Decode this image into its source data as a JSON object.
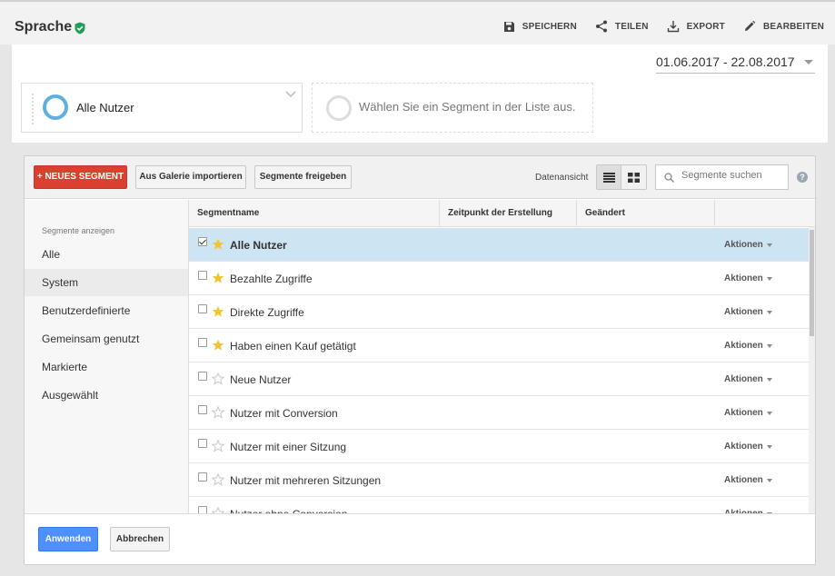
{
  "header": {
    "title": "Sprache",
    "actions": [
      {
        "label": "SPEICHERN",
        "icon": "save-icon"
      },
      {
        "label": "TEILEN",
        "icon": "share-icon"
      },
      {
        "label": "EXPORT",
        "icon": "export-icon"
      },
      {
        "label": "BEARBEITEN",
        "icon": "edit-icon"
      }
    ]
  },
  "segment_bar": {
    "date_range": "01.06.2017 - 22.08.2017",
    "active_segment": "Alle Nutzer",
    "placeholder": "Wählen Sie ein Segment in der Liste aus."
  },
  "toolbar": {
    "new_segment": "+ NEUES SEGMENT",
    "import_gallery": "Aus Galerie importieren",
    "share_segments": "Segmente freigeben",
    "view_label": "Datenansicht",
    "search_placeholder": "Segmente suchen",
    "help": "?"
  },
  "sidebar": {
    "heading": "Segmente anzeigen",
    "items": [
      {
        "label": "Alle",
        "active": false
      },
      {
        "label": "System",
        "active": true
      },
      {
        "label": "Benutzerdefinierte",
        "active": false
      },
      {
        "label": "Gemeinsam genutzt",
        "active": false
      },
      {
        "label": "Markierte",
        "active": false
      },
      {
        "label": "Ausgewählt",
        "active": false
      }
    ]
  },
  "table": {
    "columns": [
      "Segmentname",
      "Zeitpunkt der Erstellung",
      "Geändert"
    ],
    "action_label": "Aktionen",
    "rows": [
      {
        "name": "Alle Nutzer",
        "starred": true,
        "checked": true,
        "selected": true
      },
      {
        "name": "Bezahlte Zugriffe",
        "starred": true,
        "checked": false,
        "selected": false
      },
      {
        "name": "Direkte Zugriffe",
        "starred": true,
        "checked": false,
        "selected": false
      },
      {
        "name": "Haben einen Kauf getätigt",
        "starred": true,
        "checked": false,
        "selected": false
      },
      {
        "name": "Neue Nutzer",
        "starred": false,
        "checked": false,
        "selected": false
      },
      {
        "name": "Nutzer mit Conversion",
        "starred": false,
        "checked": false,
        "selected": false
      },
      {
        "name": "Nutzer mit einer Sitzung",
        "starred": false,
        "checked": false,
        "selected": false
      },
      {
        "name": "Nutzer mit mehreren Sitzungen",
        "starred": false,
        "checked": false,
        "selected": false
      },
      {
        "name": "Nutzer ohne Conversion",
        "starred": false,
        "checked": false,
        "selected": false
      }
    ]
  },
  "footer": {
    "apply": "Anwenden",
    "cancel": "Abbrechen"
  },
  "colors": {
    "accent_red": "#d9412e",
    "accent_blue": "#4d90fe",
    "selected_row": "#cde4f3",
    "star_filled": "#f4c430",
    "verified_green": "#1e9e57"
  }
}
